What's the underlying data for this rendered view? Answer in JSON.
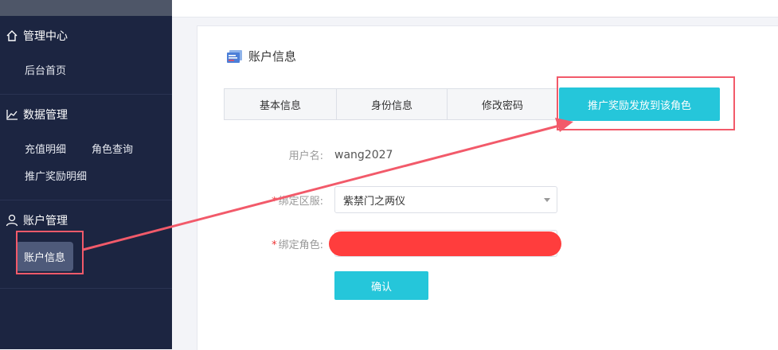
{
  "sidebar": {
    "sections": [
      {
        "title": "管理中心",
        "icon": "home-icon",
        "items": [
          [
            "后台首页"
          ]
        ]
      },
      {
        "title": "数据管理",
        "icon": "chart-line-icon",
        "items": [
          [
            "充值明细",
            "角色查询"
          ],
          [
            "推广奖励明细"
          ]
        ]
      },
      {
        "title": "账户管理",
        "icon": "user-icon",
        "items": [
          [
            "账户信息"
          ]
        ]
      }
    ]
  },
  "panel": {
    "title": "账户信息",
    "tabs": [
      "基本信息",
      "身份信息",
      "修改密码",
      "推广奖励发放到该角色"
    ],
    "username_label": "用户名:",
    "username_value": "wang2027",
    "server_label": "绑定区服:",
    "server_value": "紫禁门之两仪",
    "role_label": "绑定角色:",
    "confirm_label": "确认"
  },
  "colors": {
    "sidebar_bg": "#1c2541",
    "accent": "#25c6da",
    "annotation": "#f25a6a",
    "redaction": "#ff3d3d"
  }
}
